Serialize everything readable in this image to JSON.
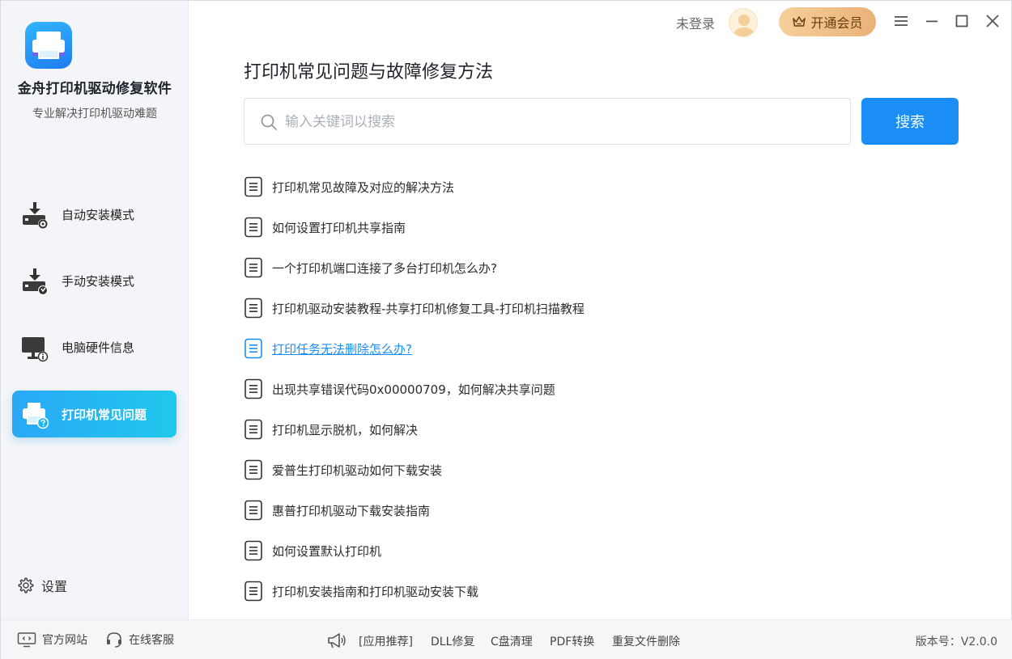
{
  "app": {
    "name": "金舟打印机驱动修复软件",
    "slogan": "专业解决打印机驱动难题"
  },
  "header": {
    "login_text": "未登录",
    "vip_label": "开通会员"
  },
  "sidebar": {
    "items": [
      {
        "label": "自动安装模式",
        "icon": "auto-install-icon"
      },
      {
        "label": "手动安装模式",
        "icon": "manual-install-icon"
      },
      {
        "label": "电脑硬件信息",
        "icon": "hardware-info-icon"
      },
      {
        "label": "打印机常见问题",
        "icon": "printer-faq-icon",
        "active": true
      }
    ],
    "settings_label": "设置"
  },
  "main": {
    "title": "打印机常见问题与故障修复方法",
    "search": {
      "placeholder": "输入关键词以搜索",
      "value": "",
      "button": "搜索"
    },
    "faq": [
      "打印机常见故障及对应的解决方法",
      "如何设置打印机共享指南",
      "一个打印机端口连接了多台打印机怎么办?",
      "打印机驱动安装教程-共享打印机修复工具-打印机扫描教程",
      "打印任务无法删除怎么办?",
      "出现共享错误代码0x00000709，如何解决共享问题",
      "打印机显示脱机，如何解决",
      "爱普生打印机驱动如何下载安装",
      "惠普打印机驱动下载安装指南",
      "如何设置默认打印机",
      "打印机安装指南和打印机驱动安装下载"
    ],
    "hovered_index": 4
  },
  "footer": {
    "official_site": "官方网站",
    "online_service": "在线客服",
    "recommend": "[应用推荐]",
    "apps": [
      "DLL修复",
      "C盘清理",
      "PDF转换",
      "重复文件删除"
    ],
    "version": "版本号：V2.0.0"
  },
  "colors": {
    "accent": "#1b8ef5",
    "active_nav_start": "#2aa8f7",
    "active_nav_end": "#1fc8ec",
    "vip_gold": "#e9b27a"
  }
}
